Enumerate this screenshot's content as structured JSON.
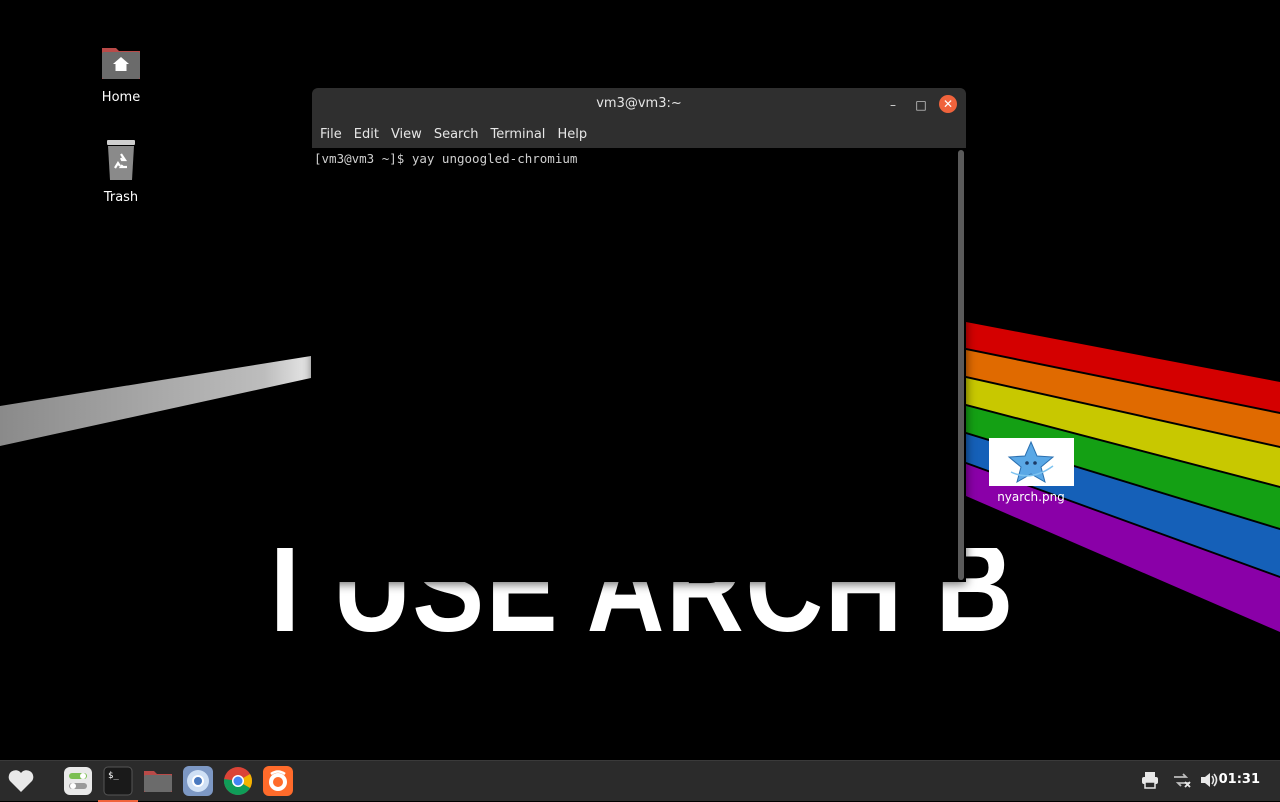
{
  "desktop": {
    "wallpaper_text": "I USE ARCH BTW",
    "icons": [
      {
        "label": "Home"
      },
      {
        "label": "Trash"
      },
      {
        "label": "nyarch.png"
      }
    ]
  },
  "window": {
    "title": "vm3@vm3:~",
    "menu": [
      "File",
      "Edit",
      "View",
      "Search",
      "Terminal",
      "Help"
    ],
    "terminal_line": "[vm3@vm3 ~]$ yay ungoogled-chromium"
  },
  "taskbar": {
    "apps": [
      "favorites-icon",
      "settings-toggle-icon",
      "terminal-icon",
      "files-folder-icon",
      "chromium-icon",
      "chrome-icon",
      "firefox-icon"
    ],
    "tray": [
      "printer-icon",
      "network-disconnected-icon",
      "volume-icon"
    ],
    "clock": "01:31"
  },
  "colors": {
    "accent": "#f0633c",
    "taskbar_bg": "#2b2b2b",
    "titlebar_bg": "#2f2f2f"
  }
}
